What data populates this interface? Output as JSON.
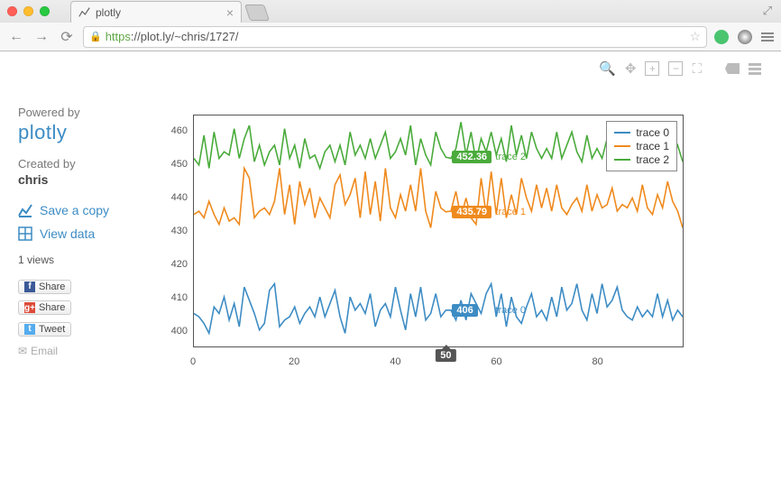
{
  "browser": {
    "tab_title": "plotly",
    "url_proto": "https",
    "url_rest": "://plot.ly/~chris/1727/"
  },
  "sidebar": {
    "powered_by": "Powered by",
    "brand": "plotly",
    "created_by": "Created by",
    "author": "chris",
    "save_copy": "Save a copy",
    "view_data": "View data",
    "views": "1 views",
    "share": "Share",
    "tweet": "Tweet",
    "email": "Email"
  },
  "chart_data": {
    "type": "line",
    "x": [
      0,
      1,
      2,
      3,
      4,
      5,
      6,
      7,
      8,
      9,
      10,
      11,
      12,
      13,
      14,
      15,
      16,
      17,
      18,
      19,
      20,
      21,
      22,
      23,
      24,
      25,
      26,
      27,
      28,
      29,
      30,
      31,
      32,
      33,
      34,
      35,
      36,
      37,
      38,
      39,
      40,
      41,
      42,
      43,
      44,
      45,
      46,
      47,
      48,
      49,
      50,
      51,
      52,
      53,
      54,
      55,
      56,
      57,
      58,
      59,
      60,
      61,
      62,
      63,
      64,
      65,
      66,
      67,
      68,
      69,
      70,
      71,
      72,
      73,
      74,
      75,
      76,
      77,
      78,
      79,
      80,
      81,
      82,
      83,
      84,
      85,
      86,
      87,
      88,
      89,
      90,
      91,
      92,
      93,
      94,
      95,
      96,
      97
    ],
    "series": [
      {
        "name": "trace 0",
        "color": "#3d8cc4",
        "values": [
          405,
          404,
          402,
          399,
          407,
          405,
          410,
          403,
          408,
          401,
          413,
          409,
          405,
          400,
          402,
          412,
          414,
          401,
          403,
          404,
          407,
          402,
          405,
          407,
          404,
          410,
          404,
          408,
          412,
          404,
          399,
          410,
          406,
          408,
          405,
          411,
          401,
          406,
          408,
          404,
          413,
          406,
          400,
          411,
          404,
          413,
          403,
          405,
          411,
          404,
          406,
          406,
          403,
          409,
          403,
          411,
          408,
          405,
          411,
          414,
          404,
          411,
          401,
          410,
          404,
          402,
          407,
          411,
          404,
          406,
          403,
          410,
          404,
          413,
          406,
          408,
          414,
          406,
          403,
          411,
          405,
          414,
          407,
          409,
          413,
          406,
          404,
          403,
          407,
          404,
          406,
          404,
          411,
          404,
          409,
          403,
          406,
          404
        ]
      },
      {
        "name": "trace 1",
        "color": "#ef8a1d",
        "values": [
          435,
          436,
          434,
          439,
          435,
          432,
          437,
          433,
          434,
          432,
          449,
          446,
          434,
          436,
          437,
          435,
          439,
          449,
          435,
          444,
          432,
          445,
          438,
          443,
          434,
          440,
          437,
          434,
          444,
          447,
          438,
          441,
          446,
          434,
          448,
          435,
          445,
          433,
          449,
          437,
          434,
          441,
          436,
          444,
          436,
          449,
          436,
          431,
          442,
          437,
          435.79,
          436,
          442,
          434,
          440,
          434,
          432,
          446,
          435,
          448,
          435,
          446,
          434,
          441,
          435,
          446,
          440,
          436,
          444,
          437,
          443,
          436,
          444,
          437,
          435,
          438,
          440,
          436,
          444,
          436,
          441,
          437,
          438,
          443,
          436,
          438,
          437,
          440,
          436,
          444,
          437,
          435,
          441,
          437,
          445,
          439,
          436,
          431
        ]
      },
      {
        "name": "trace 2",
        "color": "#4aab3b",
        "values": [
          452,
          450,
          459,
          449,
          460,
          452,
          454,
          453,
          461,
          452,
          458,
          462,
          451,
          456,
          450,
          454,
          456,
          450,
          461,
          452,
          456,
          449,
          458,
          452,
          453,
          449,
          454,
          456,
          451,
          456,
          450,
          460,
          453,
          456,
          452,
          458,
          452,
          456,
          460,
          452,
          454,
          458,
          453,
          462,
          450,
          458,
          453,
          450,
          460,
          455,
          452.36,
          452,
          455,
          463,
          453,
          460,
          451,
          458,
          454,
          460,
          453,
          458,
          451,
          462,
          453,
          459,
          452,
          460,
          455,
          452,
          455,
          452,
          460,
          452,
          456,
          460,
          454,
          451,
          459,
          452,
          455,
          452,
          458,
          454,
          452,
          459,
          453,
          459,
          454,
          450,
          462,
          454,
          456,
          450,
          459,
          453,
          456,
          451
        ]
      }
    ],
    "yticks": [
      400,
      410,
      420,
      430,
      440,
      450,
      460
    ],
    "xticks": [
      0,
      20,
      40,
      60,
      80
    ],
    "ylim": [
      395,
      465
    ],
    "xlim": [
      0,
      97
    ],
    "hover": {
      "x": 50,
      "labels": [
        {
          "series": 2,
          "value": "452.36"
        },
        {
          "series": 1,
          "value": "435.79"
        },
        {
          "series": 0,
          "value": "406"
        }
      ]
    },
    "legend": [
      "trace 0",
      "trace 1",
      "trace 2"
    ]
  }
}
